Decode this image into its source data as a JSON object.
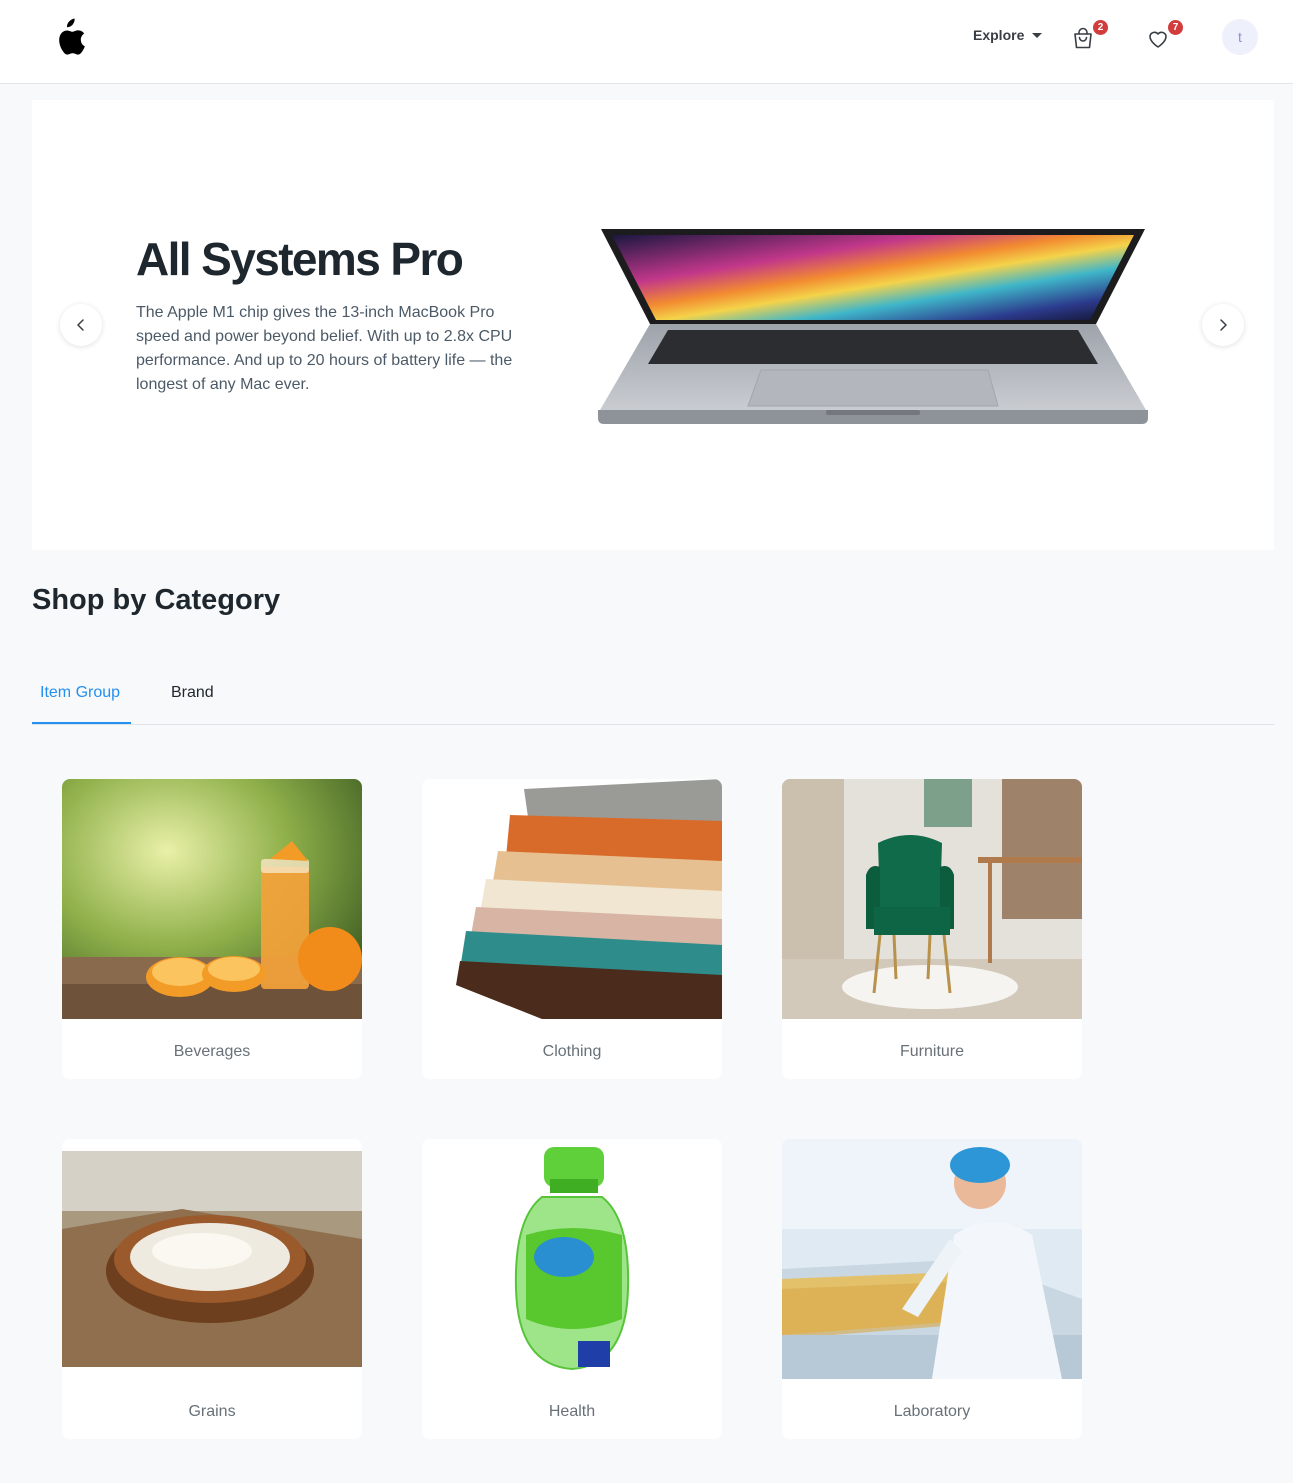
{
  "header": {
    "explore_label": "Explore",
    "cart_count": "2",
    "wishlist_count": "7",
    "avatar_initial": "t"
  },
  "hero": {
    "title": "All Systems Pro",
    "description": "The Apple M1 chip gives the 13-inch MacBook Pro speed and power beyond belief. With up to 2.8x CPU performance. And up to 20 hours of battery life — the longest of any Mac ever."
  },
  "category": {
    "title": "Shop by Category",
    "tabs": [
      {
        "label": "Item Group",
        "active": true
      },
      {
        "label": "Brand",
        "active": false
      }
    ],
    "items": [
      {
        "label": "Beverages"
      },
      {
        "label": "Clothing"
      },
      {
        "label": "Furniture"
      },
      {
        "label": "Grains"
      },
      {
        "label": "Health"
      },
      {
        "label": "Laboratory"
      }
    ]
  },
  "colors": {
    "accent": "#2490ef",
    "badge": "#d13d3d",
    "text_dark": "#1f272e",
    "text_muted": "#687178"
  }
}
